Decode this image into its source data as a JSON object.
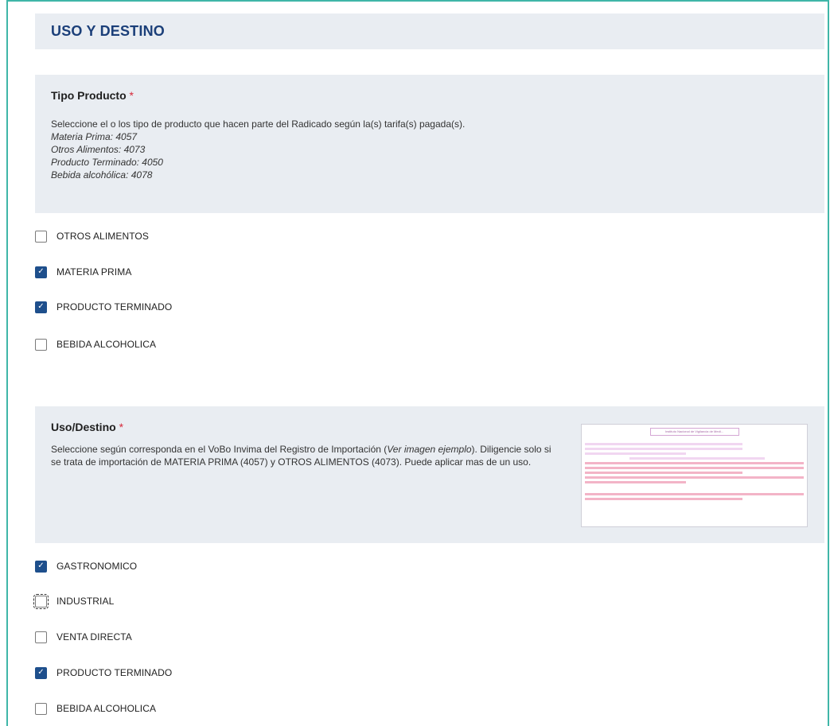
{
  "section": {
    "title": "USO Y DESTINO"
  },
  "tipo_producto": {
    "title": "Tipo Producto",
    "required_mark": "*",
    "description": "Seleccione el o los tipo de producto que hacen parte del Radicado según la(s) tarifa(s) pagada(s).",
    "tariffs": [
      "Materia Prima: 4057",
      "Otros Alimentos: 4073",
      "Producto Terminado: 4050",
      "Bebida alcohólica: 4078"
    ],
    "options": [
      {
        "label": "OTROS ALIMENTOS",
        "checked": false
      },
      {
        "label": "MATERIA PRIMA",
        "checked": true
      },
      {
        "label": "PRODUCTO TERMINADO",
        "checked": true
      },
      {
        "label": "BEBIDA ALCOHOLICA",
        "checked": false
      }
    ]
  },
  "uso_destino": {
    "title": "Uso/Destino",
    "required_mark": "*",
    "description_before_link": "Seleccione según corresponda en el VoBo Invima del Registro de Importación (",
    "link_text": "Ver imagen ejemplo",
    "description_after_link": "). Diligencie solo si se trata de importación de MATERIA PRIMA (4057) y OTROS ALIMENTOS (4073). Puede aplicar mas de un uso.",
    "example_image_caption": "Instituto Nacional de Vigilancia de Medi...",
    "options": [
      {
        "label": "GASTRONOMICO",
        "checked": true
      },
      {
        "label": "INDUSTRIAL",
        "checked": false,
        "focused": true
      },
      {
        "label": "VENTA DIRECTA",
        "checked": false
      },
      {
        "label": "PRODUCTO TERMINADO",
        "checked": true
      },
      {
        "label": "BEBIDA ALCOHOLICA",
        "checked": false
      }
    ]
  },
  "icons": {
    "checkmark": "check-icon"
  }
}
